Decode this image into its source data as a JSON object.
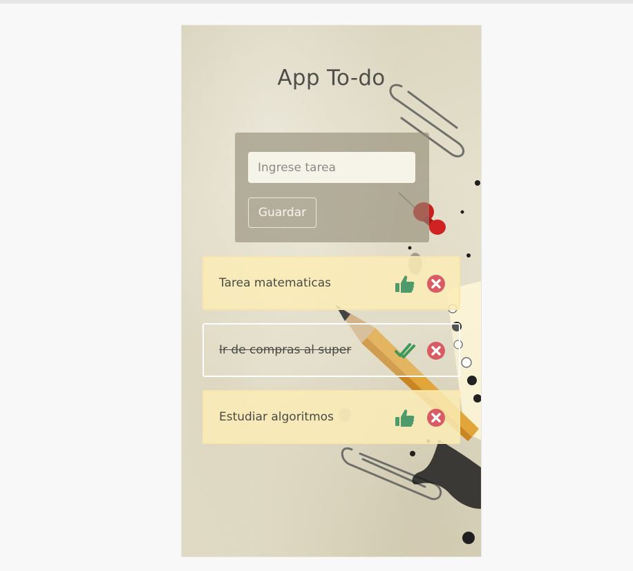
{
  "app": {
    "title": "App To-do"
  },
  "form": {
    "input_placeholder": "Ingrese tarea",
    "input_value": "",
    "save_label": "Guardar"
  },
  "tasks": [
    {
      "text": "Tarea matematicas",
      "completed": false,
      "action_icon": "thumbs-up-icon",
      "delete_icon": "delete-icon"
    },
    {
      "text": "Ir de compras al super",
      "completed": true,
      "action_icon": "double-check-icon",
      "delete_icon": "delete-icon"
    },
    {
      "text": "Estudiar algoritmos",
      "completed": false,
      "action_icon": "thumbs-up-icon",
      "delete_icon": "delete-icon"
    }
  ],
  "colors": {
    "like": "#4e9a6b",
    "check": "#3f9a5a",
    "delete": "#d95c64",
    "pending_card": "#fcecb6",
    "form_card": "#918a76"
  }
}
